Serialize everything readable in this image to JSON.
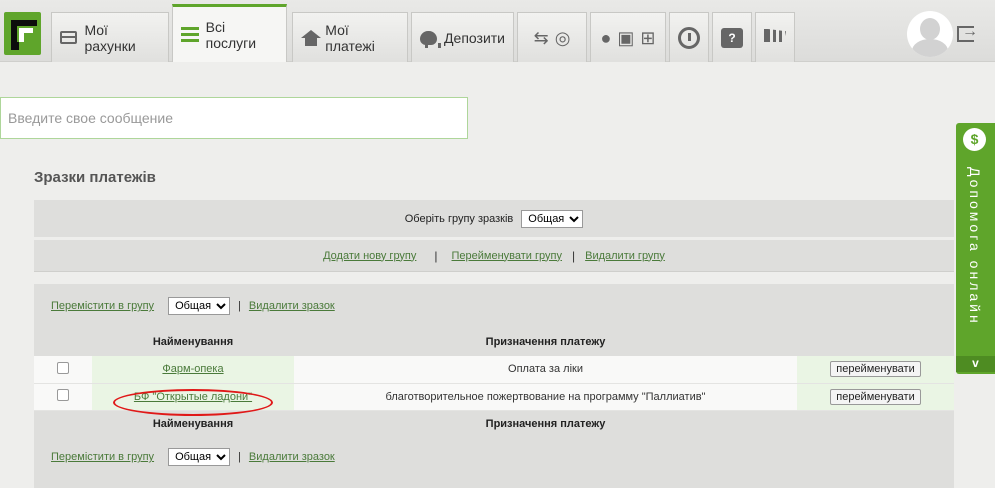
{
  "nav": {
    "tabs": [
      {
        "label": "Мої рахунки",
        "icon": "card-icon"
      },
      {
        "label": "Всі послуги",
        "icon": "list-icon"
      },
      {
        "label": "Мої платежі",
        "icon": "home-icon"
      },
      {
        "label": "Депозити",
        "icon": "piggy-bank-icon"
      }
    ],
    "icon_tabs": [
      "transport-icon",
      "mobile-platforms-icon",
      "history-icon",
      "help-question-icon",
      "cart-icon"
    ],
    "accent_color": "#5fa52b"
  },
  "message": {
    "placeholder": "Введите свое сообщение"
  },
  "samples": {
    "title": "Зразки платежів",
    "group_label": "Оберіть групу зразків",
    "group_value": "Общая",
    "group_links": {
      "add": "Додати нову групу",
      "rename": "Перейменувати групу",
      "delete": "Видалити групу"
    },
    "actions": {
      "move": "Перемістити в групу",
      "group_value": "Общая",
      "delete_sample": "Видалити зразок"
    },
    "columns": {
      "name": "Найменування",
      "purpose": "Призначення платежу"
    },
    "rows": [
      {
        "name": "Фарм-опека",
        "purpose": "Оплата за ліки",
        "button": "перейменувати"
      },
      {
        "name": "БФ \"Открытые ладони\"",
        "purpose": "благотворительное пожертвование на программу \"Паллиатив\"",
        "button": "перейменувати"
      }
    ]
  },
  "help_widget": {
    "coin": "$",
    "label": "Допомога онлайн",
    "chevron": "v"
  }
}
